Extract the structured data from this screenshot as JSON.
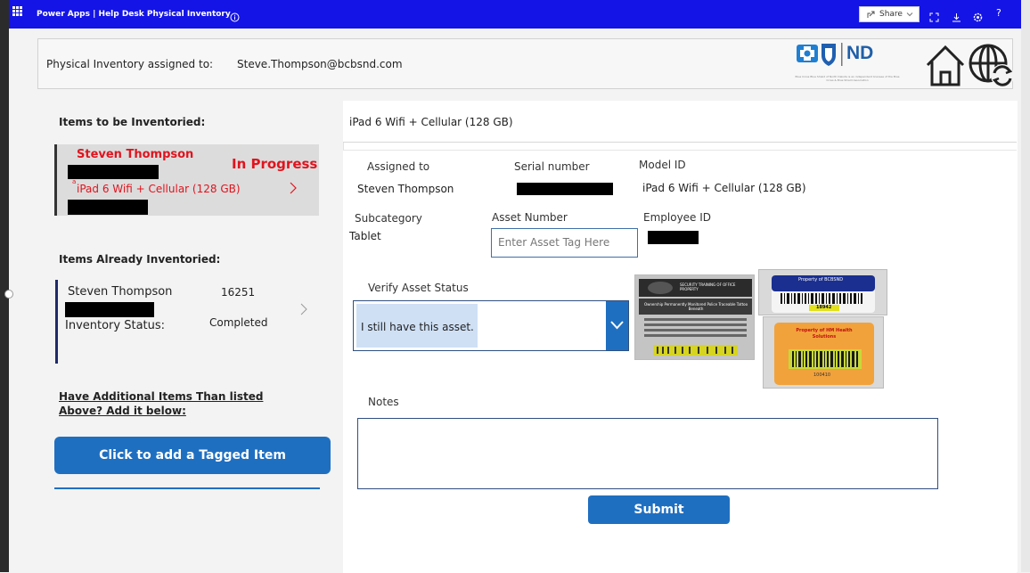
{
  "topbar": {
    "app_title": "Power Apps  |  Help Desk Physical Inventory",
    "share_label": "Share",
    "icons": [
      "waffle-icon",
      "info-icon",
      "share-icon",
      "chevron-down-icon",
      "expand-icon",
      "download-icon",
      "settings-icon",
      "help-icon"
    ]
  },
  "header": {
    "assigned_label": "Physical Inventory assigned to:",
    "assigned_email": "Steve.Thompson@bcbsnd.com",
    "logo_text": "ND",
    "logo_caption": "Blue Cross Blue Shield of North Dakota is an independent licensee of the Blue Cross & Blue Shield Association"
  },
  "left": {
    "to_be_title": "Items to be Inventoried:",
    "card1": {
      "name": "Steven Thompson",
      "status": "In Progress",
      "item": "iPad 6 Wifi + Cellular (128 GB)",
      "marker": "a"
    },
    "already_title": "Items Already Inventoried:",
    "card2": {
      "name": "Steven Thompson",
      "number": "16251",
      "status_label": "Inventory Status:",
      "status_value": "Completed"
    },
    "additional_title": "Have Additional Items Than listed Above? Add it below:",
    "add_button": "Click to add a Tagged Item"
  },
  "detail": {
    "title": "iPad 6 Wifi + Cellular (128 GB)",
    "assigned_to_label": "Assigned to",
    "assigned_to_value": "Steven Thompson",
    "serial_label": "Serial number",
    "model_label": "Model ID",
    "model_value": "iPad 6 Wifi + Cellular (128 GB)",
    "subcategory_label": "Subcategory",
    "subcategory_value": "Tablet",
    "asset_label": "Asset Number",
    "asset_placeholder": "Enter Asset Tag Here",
    "employee_label": "Employee ID",
    "verify_label": "Verify Asset Status",
    "verify_value": "I still have this asset.",
    "notes_label": "Notes",
    "submit_label": "Submit"
  },
  "stickers": {
    "s1_title": "SECURITY TRAINING OF OFFICE PROPERTY",
    "s1_body": "Ownership Permanently Monitored Police Traceable Tattoo Beneath",
    "s2_title": "Property of BCBSND",
    "s2_number": "18942",
    "s3_title": "Property of HM Health Solutions",
    "s3_number": "100410"
  },
  "colors": {
    "topbar": "#1414e6",
    "accent": "#1f6fc1",
    "in_progress": "#e0141e"
  }
}
